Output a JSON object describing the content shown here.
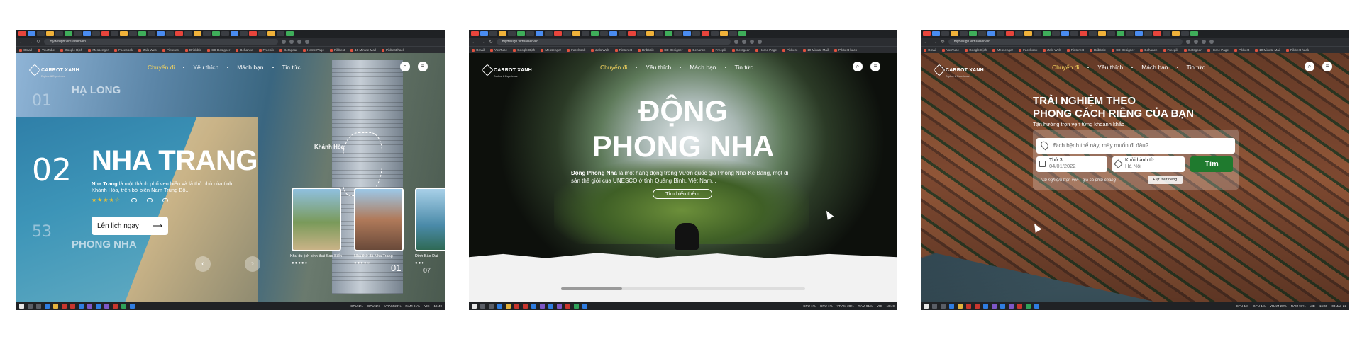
{
  "browser": {
    "url": "mydesign.virtualserver/",
    "bookmarks": [
      "Gmail",
      "YouTube",
      "Google Dịch",
      "Messenger",
      "Facebook",
      "Zalo Web",
      "Pinterest",
      "Dribbble",
      "CD Designer",
      "Behance",
      "Freepik",
      "Getsgear",
      "Home Page",
      "Pikbest",
      "10 Minute Mail",
      "Pikbest hack"
    ],
    "tray": {
      "cpu": "CPU 1%",
      "gpu": "GPU 1%",
      "vram": "VRAM 28%",
      "ram": "RAM 91%",
      "lang": "VIE",
      "time": "16:49",
      "date": "03-Jan-22"
    }
  },
  "site": {
    "logo": "CARROT XANH",
    "logo_sub": "Explore & Experience",
    "nav": [
      "Chuyến đi",
      "Yêu thích",
      "Mách bạn",
      "Tin tức"
    ],
    "search_icon": "search-icon",
    "menu_icon": "hamburger-icon"
  },
  "slide1": {
    "prev_num": "01",
    "cur_num": "02",
    "total_num": "53",
    "prev_place": "HẠ LONG",
    "next_place": "PHONG NHA",
    "title": "NHA TRANG",
    "desc_bold": "Nha Trang",
    "desc_rest": " là một thành phố ven biển và là thủ phủ của tỉnh Khánh Hòa, trên bờ biển Nam Trung Bộ...",
    "stars": "★★★★☆",
    "cta": "Lên lịch ngay",
    "region": "Khánh Hòa",
    "cards": [
      {
        "label": "Khu du lịch sinh thái Sao Biển",
        "color": "#7a9a5a"
      },
      {
        "label": "Nhà thờ đá Nha Trang",
        "color": "#b07a5a"
      },
      {
        "label": "Dinh Bảo Đại",
        "color": "#4a8aa8"
      }
    ],
    "page_cur": "01",
    "page_next": "07"
  },
  "slide2": {
    "title_line1": "ĐỘNG",
    "title_line2": "PHONG NHA",
    "desc_bold": "Động Phong Nha",
    "desc_rest": " là một hang động trong Vườn quốc gia Phong Nha-Kẻ Bàng, một di sản thế giới của UNESCO ở tỉnh Quảng Bình, Việt Nam...",
    "button": "Tìm hiểu thêm"
  },
  "slide3": {
    "title_line1": "TRẢI NGHIỆM THEO",
    "title_line2": "PHONG CÁCH RIÊNG CỦA BẠN",
    "subtitle": "Tận hưởng trọn vẹn từng khoảnh khắc",
    "search_placeholder": "Địch bệnh thế này, mày muốn đi đâu?",
    "date_label": "Thứ 3",
    "date_value": "04/01/2022",
    "from_label": "Khởi hành từ",
    "from_value": "Hà Nội",
    "find": "Tìm",
    "note": "Trải nghiệm trọn vẹn - giá cả phải chăng",
    "tour_button": "Đặt tour riêng"
  },
  "colors": {
    "accent": "#f4d35e",
    "green": "#1f7a2e"
  }
}
